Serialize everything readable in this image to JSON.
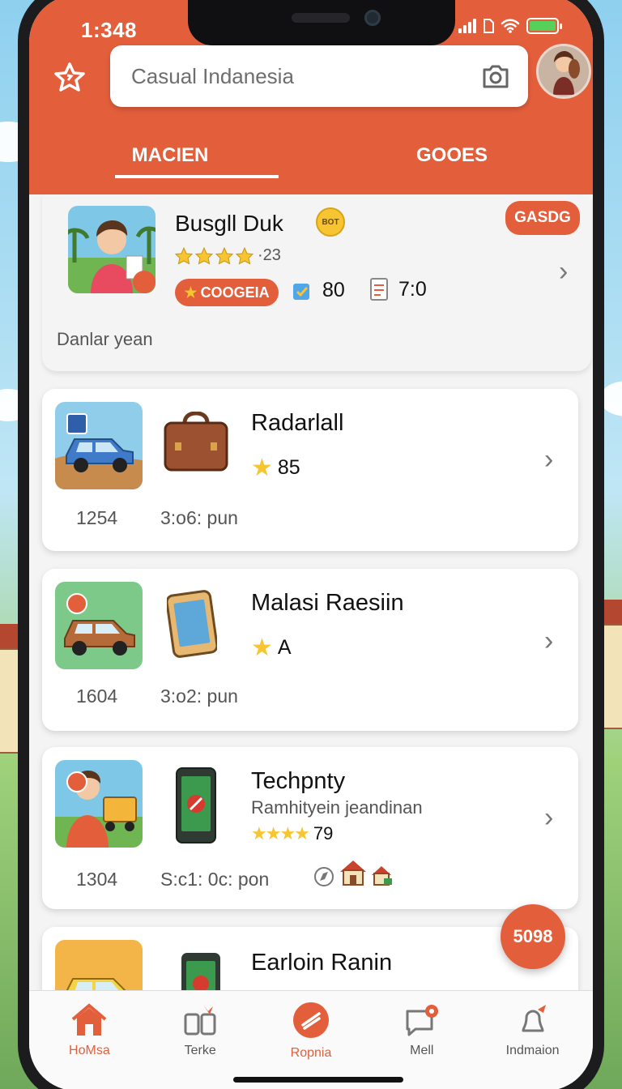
{
  "status_bar": {
    "time": "1:348"
  },
  "header": {
    "search": {
      "placeholder": "Casual Indanesia"
    },
    "tabs": [
      {
        "label": "MACIEN",
        "active": true
      },
      {
        "label": "GOOES",
        "active": false
      }
    ]
  },
  "featured": {
    "title": "Busgll Duk",
    "title_badge": "BOT",
    "rating_text": "·23",
    "category_pill": "COOGEIA",
    "stat_a": "80",
    "stat_b": "7:0",
    "action_pill": "GASDG",
    "caption": "Danlar yean"
  },
  "cards": [
    {
      "name": "Radarlall",
      "rating": "85",
      "count": "1254",
      "meta": "3:o6: pun"
    },
    {
      "name": "Malasi Raesiin",
      "rating": "A",
      "count": "1604",
      "meta": "3:o2: pun"
    },
    {
      "name": "Techpnty",
      "subtitle": "Ramhityein jeandinan",
      "rating": "79",
      "count": "1304",
      "meta": "S:c1:  0c: pon"
    },
    {
      "name": "Earloin Ranin"
    }
  ],
  "fab": {
    "label": "5098"
  },
  "bottom_nav": [
    {
      "label": "HoMsa",
      "icon": "home-icon",
      "active": true
    },
    {
      "label": "Terke",
      "icon": "grid-icon",
      "active": false
    },
    {
      "label": "Ropnia",
      "icon": "compass-icon",
      "active": true
    },
    {
      "label": "Mell",
      "icon": "mail-icon",
      "active": false
    },
    {
      "label": "Indmaion",
      "icon": "bell-icon",
      "active": false
    }
  ],
  "colors": {
    "accent": "#e35e3b",
    "star": "#f6c531"
  }
}
